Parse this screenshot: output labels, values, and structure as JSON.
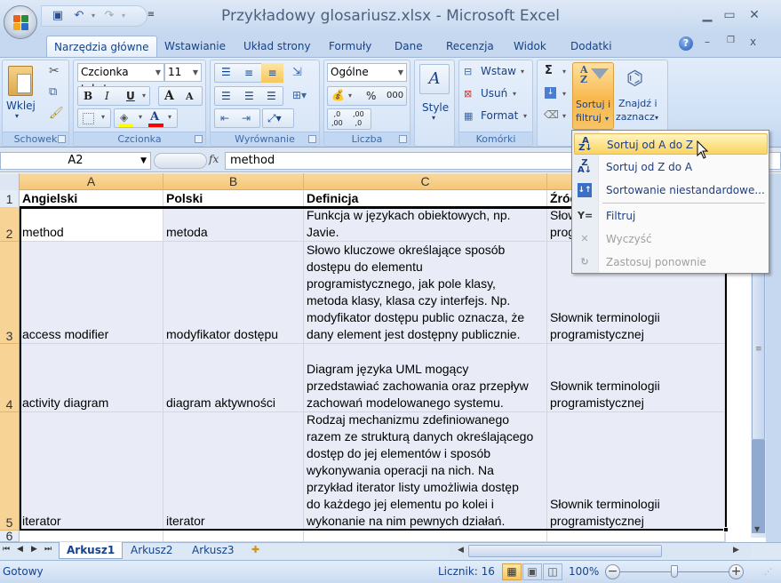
{
  "window": {
    "title": "Przykładowy glosariusz.xlsx - Microsoft Excel",
    "minimize_label": "_",
    "maximize_label": "□",
    "close_label": "✕"
  },
  "quick_access": {
    "save_icon": "save-icon",
    "undo_icon": "undo-icon",
    "redo_icon": "redo-icon",
    "customize_icon": "customize-qat-icon"
  },
  "tabs": [
    {
      "label": "Narzędzia główne",
      "active": true
    },
    {
      "label": "Wstawianie"
    },
    {
      "label": "Układ strony"
    },
    {
      "label": "Formuły"
    },
    {
      "label": "Dane"
    },
    {
      "label": "Recenzja"
    },
    {
      "label": "Widok"
    },
    {
      "label": "Dodatki"
    }
  ],
  "ribbon": {
    "clipboard": {
      "label": "Schowek",
      "paste": "Wklej"
    },
    "font": {
      "label": "Czcionka",
      "font_name": "Czcionka tekstu",
      "font_size": "11",
      "bold": "B",
      "italic": "I",
      "underline": "U",
      "grow": "A",
      "shrink": "A",
      "font_color": "A"
    },
    "alignment": {
      "label": "Wyrównanie"
    },
    "number": {
      "label": "Liczba",
      "format": "Ogólne",
      "percent": "%",
      "thousands": "000",
      "inc_decimal": ",0\n,00",
      "dec_decimal": ",00\n,0"
    },
    "styles": {
      "label": "Style"
    },
    "cells": {
      "label": "Komórki",
      "insert": "Wstaw",
      "delete": "Usuń",
      "format": "Format"
    },
    "editing": {
      "autosum": "Σ",
      "sort_filter_line1": "Sortuj i",
      "sort_filter_line2": "filtruj",
      "find_line1": "Znajdź i",
      "find_line2": "zaznacz"
    }
  },
  "formula_bar": {
    "name_box": "A2",
    "fx": "fx",
    "value": "method"
  },
  "sheet": {
    "columns": [
      "A",
      "B",
      "C"
    ],
    "rows": [
      {
        "num": "1",
        "cells": [
          "Angielski",
          "Polski",
          "Definicja",
          "Źródło"
        ]
      },
      {
        "num": "2",
        "cells": [
          "method",
          "metoda",
          "Funkcja w językach obiektowych, np.\nJavie.",
          "Słownik terminologii\nprogramistycznej"
        ]
      },
      {
        "num": "3",
        "cells": [
          "access modifier",
          "modyfikator dostępu",
          "Słowo kluczowe określające sposób\ndostępu do elementu\nprogramistycznego, jak pole klasy,\nmetoda klasy, klasa czy interfejs. Np.\nmodyfikator dostępu public oznacza, że\ndany element jest dostępny publicznie.",
          "Słownik terminologii\nprogramistycznej"
        ]
      },
      {
        "num": "4",
        "cells": [
          "activity diagram",
          "diagram aktywności",
          "Diagram języka UML mogący\nprzedstawiać zachowania oraz przepływ\nzachowań modelowanego systemu.",
          "Słownik terminologii\nprogramistycznej"
        ]
      },
      {
        "num": "5",
        "cells": [
          "iterator",
          "iterator",
          "Rodzaj mechanizmu zdefiniowanego\nrazem ze strukturą danych określającego\ndostęp do jej elementów i sposób\nwykonywania operacji na nich. Na\nprzykład iterator listy umożliwia dostęp\ndo każdego jej elementu po kolei i\nwykonanie na nim pewnych działań.",
          "Słownik terminologii\nprogramistycznej"
        ]
      },
      {
        "num": "6",
        "cells": [
          "",
          "",
          "",
          ""
        ]
      }
    ]
  },
  "sort_menu": {
    "items": [
      {
        "label": "Sortuj od A do Z",
        "icon": "sort-a-z-icon",
        "highlighted": true
      },
      {
        "label": "Sortuj od Z do A",
        "icon": "sort-z-a-icon"
      },
      {
        "label": "Sortowanie niestandardowe...",
        "icon": "custom-sort-icon"
      },
      {
        "label": "Filtruj",
        "icon": "filter-icon"
      },
      {
        "label": "Wyczyść",
        "icon": "clear-filter-icon",
        "disabled": true
      },
      {
        "label": "Zastosuj ponownie",
        "icon": "reapply-filter-icon",
        "disabled": true
      }
    ]
  },
  "sheet_tabs": [
    {
      "label": "Arkusz1",
      "active": true
    },
    {
      "label": "Arkusz2"
    },
    {
      "label": "Arkusz3"
    }
  ],
  "status_bar": {
    "ready": "Gotowy",
    "count": "Licznik: 16",
    "zoom": "100%",
    "zoom_percent": 100
  }
}
